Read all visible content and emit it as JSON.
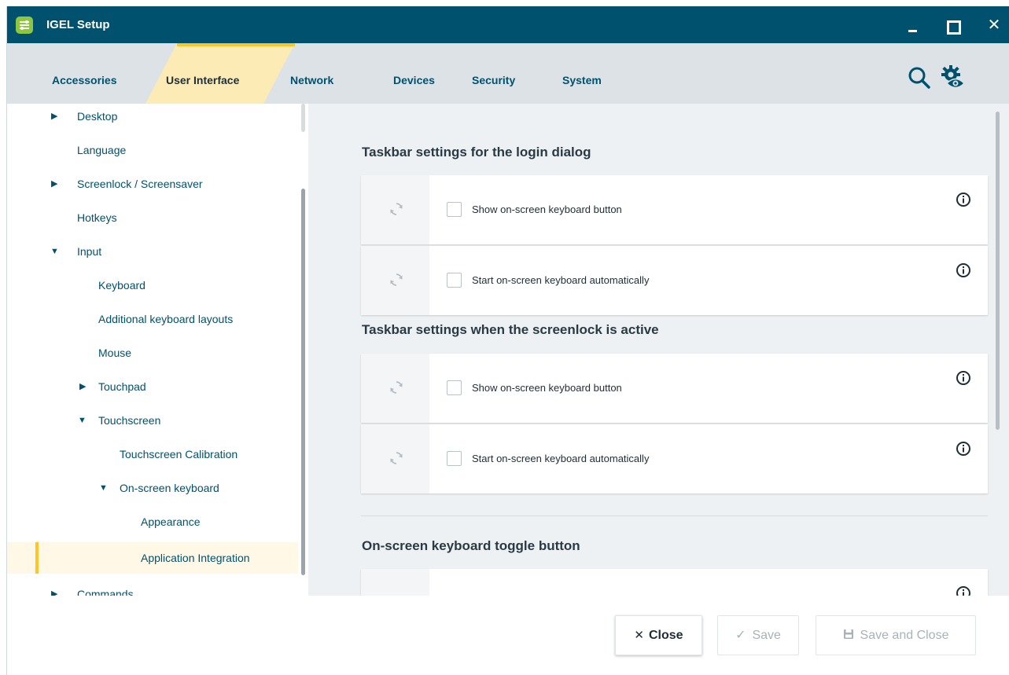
{
  "window": {
    "title": "IGEL Setup"
  },
  "tabs": [
    {
      "label": "Accessories",
      "active": false
    },
    {
      "label": "User Interface",
      "active": true
    },
    {
      "label": "Network",
      "active": false
    },
    {
      "label": "Devices",
      "active": false
    },
    {
      "label": "Security",
      "active": false
    },
    {
      "label": "System",
      "active": false
    }
  ],
  "toolbar": {
    "search_icon": "search-icon",
    "view_settings_icon": "gear-eye-icon"
  },
  "sidebar": {
    "items": [
      {
        "label": "Desktop",
        "expander": "collapsed"
      },
      {
        "label": "Language"
      },
      {
        "label": "Screenlock / Screensaver",
        "expander": "collapsed"
      },
      {
        "label": "Hotkeys"
      },
      {
        "label": "Input",
        "expander": "expanded"
      },
      {
        "label": "Keyboard"
      },
      {
        "label": "Additional keyboard layouts"
      },
      {
        "label": "Mouse"
      },
      {
        "label": "Touchpad",
        "expander": "collapsed"
      },
      {
        "label": "Touchscreen",
        "expander": "expanded"
      },
      {
        "label": "Touchscreen Calibration"
      },
      {
        "label": "On-screen keyboard",
        "expander": "expanded"
      },
      {
        "label": "Appearance"
      },
      {
        "label": "Application Integration",
        "selected": true
      },
      {
        "label": "Commands",
        "expander": "collapsed"
      }
    ]
  },
  "main": {
    "sections": [
      {
        "title": "Taskbar settings for the login dialog",
        "settings": [
          {
            "label": "Show on-screen keyboard button",
            "checked": false
          },
          {
            "label": "Start on-screen keyboard automatically",
            "checked": false
          }
        ]
      },
      {
        "title": "Taskbar settings when the screenlock is active",
        "settings": [
          {
            "label": "Show on-screen keyboard button",
            "checked": false
          },
          {
            "label": "Start on-screen keyboard automatically",
            "checked": false
          }
        ]
      },
      {
        "title": "On-screen keyboard toggle button",
        "settings": [
          {
            "label": "",
            "checked": false
          }
        ]
      }
    ]
  },
  "footer": {
    "close_label": "Close",
    "save_label": "Save",
    "save_close_label": "Save and Close"
  },
  "colors": {
    "titlebar": "#00516e",
    "tabbar": "#dde2e6",
    "accent": "#ffc425",
    "active_tab": "#fcebb5",
    "link": "#00516e"
  }
}
